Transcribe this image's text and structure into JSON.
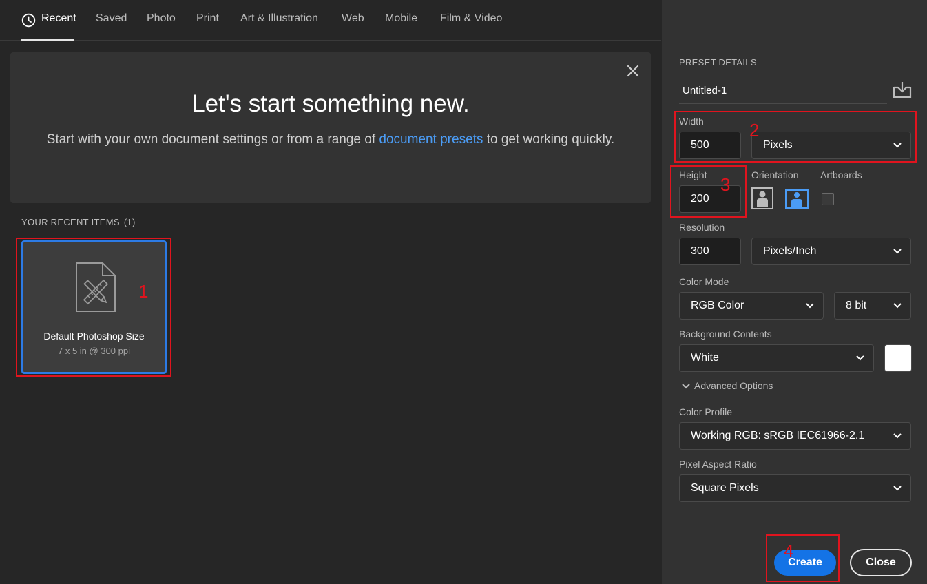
{
  "nav": {
    "tabs": [
      {
        "label": "Recent",
        "icon": "clock-icon",
        "active": true
      },
      {
        "label": "Saved"
      },
      {
        "label": "Photo"
      },
      {
        "label": "Print"
      },
      {
        "label": "Art & Illustration"
      },
      {
        "label": "Web"
      },
      {
        "label": "Mobile"
      },
      {
        "label": "Film & Video"
      }
    ]
  },
  "banner": {
    "title": "Let's start something new.",
    "subtitle_pre": "Start with your own document settings or from a range of ",
    "subtitle_link": "document presets",
    "subtitle_post": " to get working quickly.",
    "close_icon": "close-icon"
  },
  "recent": {
    "header": "YOUR RECENT ITEMS",
    "count": "(1)",
    "items": [
      {
        "name": "Default Photoshop Size",
        "desc": "7 x 5 in @ 300 ppi",
        "icon": "document-ruler-pencil-icon"
      }
    ]
  },
  "preset": {
    "section_title": "PRESET DETAILS",
    "name": "Untitled-1",
    "save_icon": "save-preset-icon",
    "width_label": "Width",
    "width_value": "500",
    "width_unit": "Pixels",
    "height_label": "Height",
    "height_value": "200",
    "orientation_label": "Orientation",
    "orientation_selected": "landscape",
    "artboards_label": "Artboards",
    "artboards_checked": false,
    "resolution_label": "Resolution",
    "resolution_value": "300",
    "resolution_unit": "Pixels/Inch",
    "color_mode_label": "Color Mode",
    "color_mode": "RGB Color",
    "bit_depth": "8 bit",
    "background_label": "Background Contents",
    "background": "White",
    "background_swatch": "#ffffff",
    "advanced_label": "Advanced Options",
    "color_profile_label": "Color Profile",
    "color_profile": "Working RGB: sRGB IEC61966-2.1",
    "pixel_aspect_label": "Pixel Aspect Ratio",
    "pixel_aspect": "Square Pixels"
  },
  "actions": {
    "create": "Create",
    "close": "Close"
  },
  "annotations": [
    "1",
    "2",
    "3",
    "4"
  ],
  "colors": {
    "accent": "#1473e6",
    "link": "#4b9cf5",
    "annotation": "#e0141e",
    "panel_bg": "#323232",
    "app_bg": "#262626"
  }
}
